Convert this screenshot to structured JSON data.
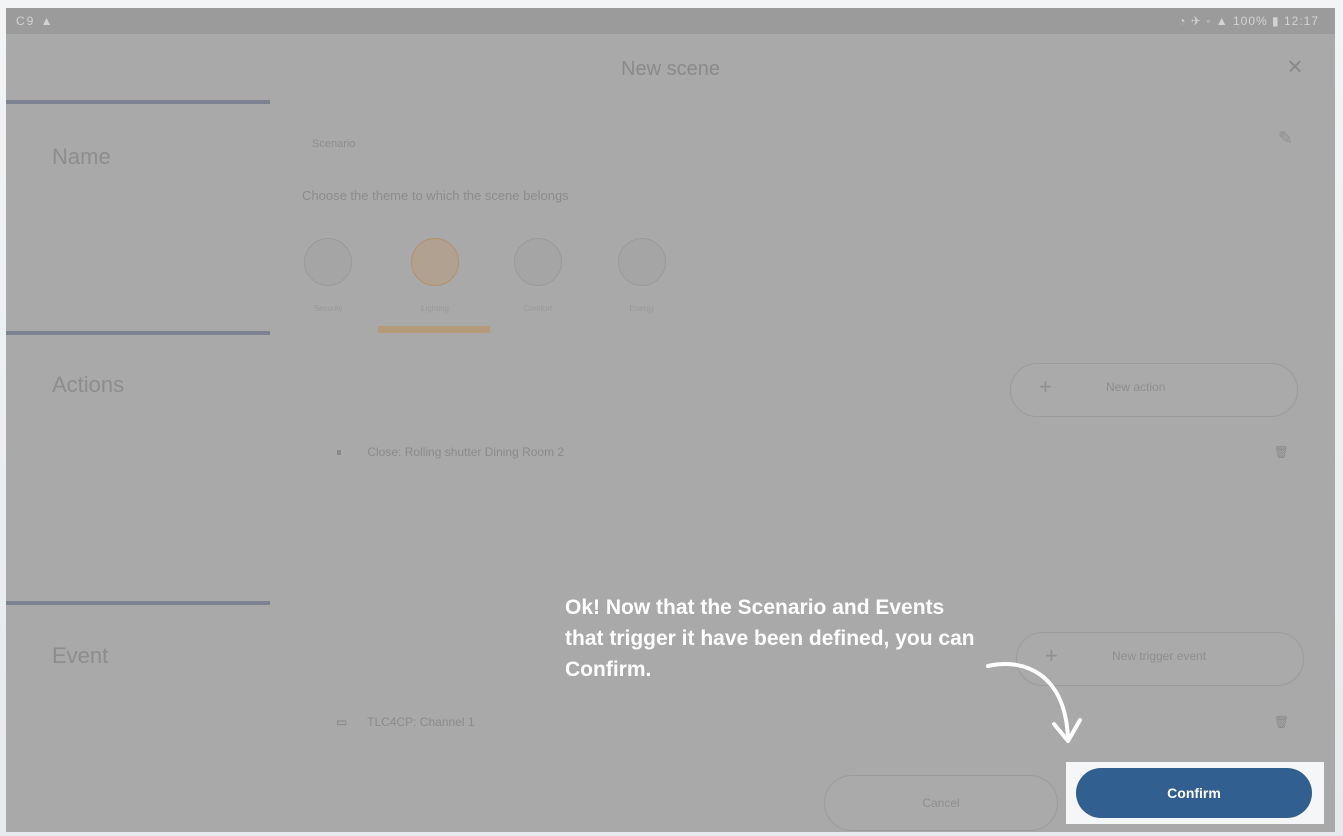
{
  "window": {
    "title": "New scene"
  },
  "status": {
    "left": "C9 ▲",
    "right": "◔ ✈ ◦ ▲ 100% ▮ 12:17"
  },
  "sections": [
    {
      "label": "Name"
    },
    {
      "label": "Actions"
    },
    {
      "label": "Event"
    }
  ],
  "name_field": {
    "placeholder": "Scenario",
    "theme_prompt": "Choose the theme to which the scene belongs"
  },
  "themes": [
    {
      "label": "Security",
      "selected": false
    },
    {
      "label": "Lighting",
      "selected": true
    },
    {
      "label": "Comfort",
      "selected": false
    },
    {
      "label": "Energy",
      "selected": false
    }
  ],
  "actions": {
    "button": "New action",
    "items": [
      {
        "text": "Close: Rolling shutter Dining Room 2"
      }
    ]
  },
  "events": {
    "button": "New trigger event",
    "items": [
      {
        "text": "TLC4CP: Channel 1"
      }
    ]
  },
  "footer": {
    "cancel": "Cancel",
    "confirm": "Confirm"
  },
  "tooltip": {
    "text": "Ok! Now that the Scenario and Events that trigger it have been defined, you can Confirm."
  },
  "colors": {
    "overlay": "#a9a9a9",
    "confirm": "#315f8f",
    "accent": "#b39a78",
    "tooltip_text": "#ffffff"
  }
}
